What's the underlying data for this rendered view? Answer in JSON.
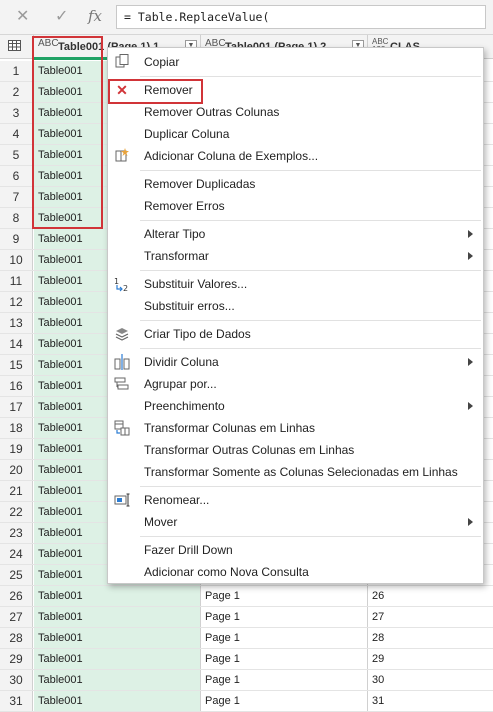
{
  "formula_bar": {
    "cancel_icon": "close-icon",
    "commit_icon": "check-icon",
    "fx_label": "fx",
    "formula": "= Table.ReplaceValue("
  },
  "grid": {
    "columns": [
      {
        "type": "ABC",
        "name": "Table001 (Page 1).1"
      },
      {
        "type": "ABC",
        "name": "Table001 (Page 1).2"
      },
      {
        "type": "ABC 123",
        "name": "CLAS"
      }
    ],
    "rows": [
      {
        "n": "1",
        "c1": "Table001",
        "c2": "",
        "c3": ""
      },
      {
        "n": "2",
        "c1": "Table001",
        "c2": "",
        "c3": ""
      },
      {
        "n": "3",
        "c1": "Table001",
        "c2": "",
        "c3": ""
      },
      {
        "n": "4",
        "c1": "Table001",
        "c2": "",
        "c3": ""
      },
      {
        "n": "5",
        "c1": "Table001",
        "c2": "",
        "c3": ""
      },
      {
        "n": "6",
        "c1": "Table001",
        "c2": "",
        "c3": ""
      },
      {
        "n": "7",
        "c1": "Table001",
        "c2": "",
        "c3": ""
      },
      {
        "n": "8",
        "c1": "Table001",
        "c2": "",
        "c3": ""
      },
      {
        "n": "9",
        "c1": "Table001",
        "c2": "",
        "c3": ""
      },
      {
        "n": "10",
        "c1": "Table001",
        "c2": "",
        "c3": ""
      },
      {
        "n": "11",
        "c1": "Table001",
        "c2": "",
        "c3": ""
      },
      {
        "n": "12",
        "c1": "Table001",
        "c2": "",
        "c3": ""
      },
      {
        "n": "13",
        "c1": "Table001",
        "c2": "",
        "c3": ""
      },
      {
        "n": "14",
        "c1": "Table001",
        "c2": "",
        "c3": ""
      },
      {
        "n": "15",
        "c1": "Table001",
        "c2": "",
        "c3": ""
      },
      {
        "n": "16",
        "c1": "Table001",
        "c2": "",
        "c3": ""
      },
      {
        "n": "17",
        "c1": "Table001",
        "c2": "",
        "c3": ""
      },
      {
        "n": "18",
        "c1": "Table001",
        "c2": "",
        "c3": ""
      },
      {
        "n": "19",
        "c1": "Table001",
        "c2": "",
        "c3": ""
      },
      {
        "n": "20",
        "c1": "Table001",
        "c2": "",
        "c3": ""
      },
      {
        "n": "21",
        "c1": "Table001",
        "c2": "",
        "c3": ""
      },
      {
        "n": "22",
        "c1": "Table001",
        "c2": "",
        "c3": ""
      },
      {
        "n": "23",
        "c1": "Table001",
        "c2": "",
        "c3": ""
      },
      {
        "n": "24",
        "c1": "Table001",
        "c2": "",
        "c3": ""
      },
      {
        "n": "25",
        "c1": "Table001",
        "c2": "",
        "c3": ""
      },
      {
        "n": "26",
        "c1": "Table001",
        "c2": "Page 1",
        "c3": "26"
      },
      {
        "n": "27",
        "c1": "Table001",
        "c2": "Page 1",
        "c3": "27"
      },
      {
        "n": "28",
        "c1": "Table001",
        "c2": "Page 1",
        "c3": "28"
      },
      {
        "n": "29",
        "c1": "Table001",
        "c2": "Page 1",
        "c3": "29"
      },
      {
        "n": "30",
        "c1": "Table001",
        "c2": "Page 1",
        "c3": "30"
      },
      {
        "n": "31",
        "c1": "Table001",
        "c2": "Page 1",
        "c3": "31"
      }
    ],
    "accent_color": "#21a366",
    "selected_column_color": "#ddf1e5",
    "highlight_color": "#d13438"
  },
  "context_menu": {
    "items": [
      {
        "label": "Copiar",
        "icon": "copy-icon",
        "submenu": false
      },
      {
        "label": "Remover",
        "icon": "remove-icon",
        "submenu": false,
        "highlighted": true
      },
      {
        "label": "Remover Outras Colunas",
        "icon": "",
        "submenu": false
      },
      {
        "label": "Duplicar Coluna",
        "icon": "",
        "submenu": false
      },
      {
        "label": "Adicionar Coluna de Exemplos...",
        "icon": "column-from-examples-icon",
        "submenu": false
      },
      {
        "label": "Remover Duplicadas",
        "icon": "",
        "submenu": false
      },
      {
        "label": "Remover Erros",
        "icon": "",
        "submenu": false
      },
      {
        "label": "Alterar Tipo",
        "icon": "",
        "submenu": true
      },
      {
        "label": "Transformar",
        "icon": "",
        "submenu": true
      },
      {
        "label": "Substituir Valores...",
        "icon": "replace-values-icon",
        "submenu": false
      },
      {
        "label": "Substituir erros...",
        "icon": "",
        "submenu": false
      },
      {
        "label": "Criar Tipo de Dados",
        "icon": "data-type-icon",
        "submenu": false
      },
      {
        "label": "Dividir Coluna",
        "icon": "split-column-icon",
        "submenu": true
      },
      {
        "label": "Agrupar por...",
        "icon": "group-by-icon",
        "submenu": false
      },
      {
        "label": "Preenchimento",
        "icon": "",
        "submenu": true
      },
      {
        "label": "Transformar Colunas em Linhas",
        "icon": "unpivot-icon",
        "submenu": false
      },
      {
        "label": "Transformar Outras Colunas em Linhas",
        "icon": "",
        "submenu": false
      },
      {
        "label": "Transformar Somente as Colunas Selecionadas em Linhas",
        "icon": "",
        "submenu": false
      },
      {
        "label": "Renomear...",
        "icon": "rename-icon",
        "submenu": false
      },
      {
        "label": "Mover",
        "icon": "",
        "submenu": true
      },
      {
        "label": "Fazer Drill Down",
        "icon": "",
        "submenu": false
      },
      {
        "label": "Adicionar como Nova Consulta",
        "icon": "",
        "submenu": false
      }
    ]
  }
}
